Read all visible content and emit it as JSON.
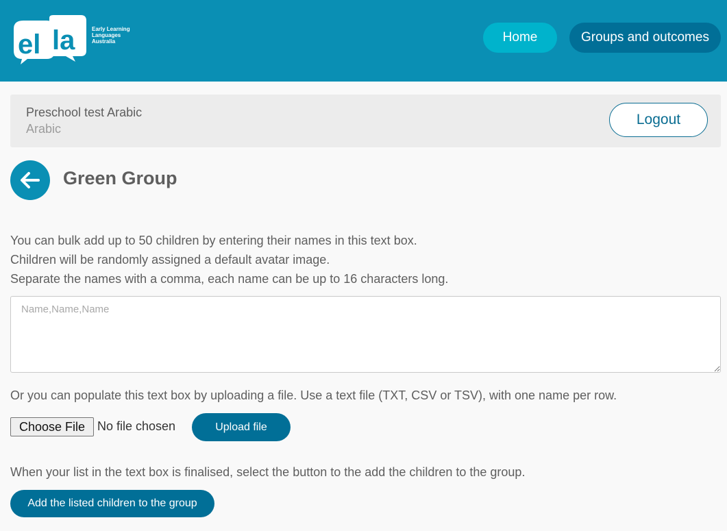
{
  "header": {
    "logo_text": "ella",
    "logo_tagline": [
      "Early Learning",
      "Languages",
      "Australia"
    ],
    "nav": {
      "home_label": "Home",
      "groups_label": "Groups and outcomes"
    }
  },
  "account": {
    "school_name": "Preschool test Arabic",
    "language": "Arabic",
    "logout_label": "Logout"
  },
  "page": {
    "title": "Green Group",
    "back_icon": "arrow-left-icon"
  },
  "bulk_add": {
    "instructions": [
      "You can bulk add up to 50 children by entering their names in this text box.",
      "Children will be randomly assigned a default avatar image.",
      "Separate the names with a comma, each name can be up to 16 characters long."
    ],
    "textarea_value": "",
    "textarea_placeholder": "Name,Name,Name",
    "upload_instruction": "Or you can populate this text box by uploading a file. Use a text file (TXT, CSV or TSV), with one name per row.",
    "choose_file_label": "Choose File",
    "file_status": "No file chosen",
    "upload_label": "Upload file",
    "finalise_instruction": "When your list in the text box is finalised, select the button to the add the children to the group.",
    "add_label": "Add the listed children to the group"
  },
  "colors": {
    "header_bg": "#0a8fb4",
    "home_button": "#00b3cc",
    "primary_button": "#016f97",
    "page_bg": "#f9f9f9",
    "info_bar": "#ececec"
  }
}
